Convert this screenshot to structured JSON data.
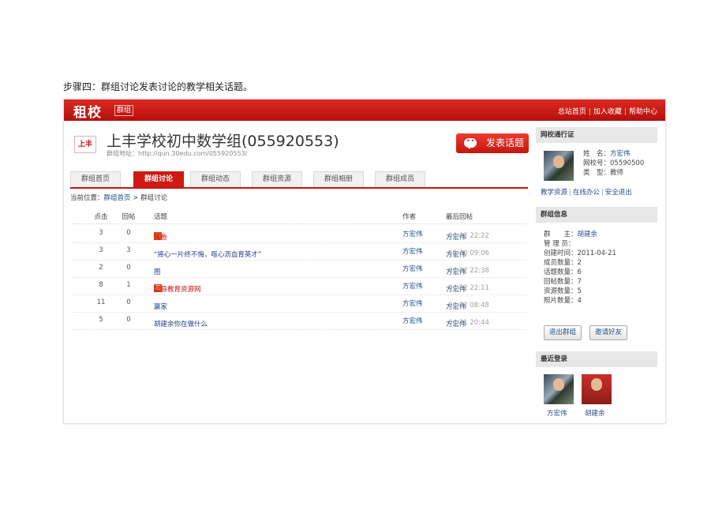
{
  "caption": "步骤四：群组讨论发表讨论的教学相关话题。",
  "topbar": {
    "logo": "租校",
    "badge": "群组",
    "links": [
      "总站首页",
      "加入收藏",
      "帮助中心"
    ]
  },
  "group": {
    "logo_text": "上丰",
    "title": "上丰学校初中数学组(055920553)",
    "url_label": "群组地址：",
    "url": "http://qun.30edu.com/055920553/",
    "post_button": "发表话题"
  },
  "tabs": [
    "群组首页",
    "群组讨论",
    "群组动态",
    "群组资源",
    "群组相册",
    "群组成员"
  ],
  "active_tab": "群组讨论",
  "breadcrumb": {
    "prefix": "当前位置：",
    "home": "群组首页",
    "sep": " > ",
    "current": "群组讨论"
  },
  "table": {
    "headers": {
      "clicks": "点击",
      "replies": "回帖",
      "topic": "话题",
      "author": "作者",
      "last": "最后回帖"
    },
    "rows": [
      {
        "clicks": "3",
        "replies": "0",
        "tag": "□",
        "topic": "鳄鱼",
        "author": "方宏伟",
        "last_user": "方宏伟",
        "last_time": "04-22 22:22"
      },
      {
        "clicks": "3",
        "replies": "3",
        "tag": "",
        "topic": "“捧心一片终不悔，呕心沥血育英才”",
        "author": "方宏伟",
        "last_user": "方宏伟",
        "last_time": "10-30 09:06"
      },
      {
        "clicks": "2",
        "replies": "0",
        "tag": "",
        "topic": "图",
        "author": "方宏伟",
        "last_user": "方宏伟",
        "last_time": "04-22 22:38"
      },
      {
        "clicks": "8",
        "replies": "1",
        "tag": "荐",
        "topic": "歙县教育资源网",
        "author": "方宏伟",
        "last_user": "方宏伟",
        "last_time": "04-22 22:11"
      },
      {
        "clicks": "11",
        "replies": "0",
        "tag": "",
        "topic": "赢家",
        "author": "方宏伟",
        "last_user": "方宏伟",
        "last_time": "04-22 08:48"
      },
      {
        "clicks": "5",
        "replies": "0",
        "tag": "",
        "topic": "胡建余你在做什么",
        "author": "方宏伟",
        "last_user": "方宏伟",
        "last_time": "04-21 20:44"
      }
    ]
  },
  "sidebar": {
    "pass_title": "网校通行证",
    "name_label": "姓　名：",
    "name": "方宏伟",
    "id_label": "网校号：",
    "id": "05590500",
    "type_label": "类　型：",
    "type": "教师",
    "quick_links": [
      "教学资源",
      "在线办公",
      "安全退出"
    ],
    "info_title": "群组信息",
    "info": {
      "owner_label": "群　　主：",
      "owner": "胡建余",
      "admin_label": "管 理 员：",
      "admin": "",
      "created_label": "创建时间：",
      "created": "2011-04-21",
      "members_label": "成员数量：",
      "members": "2",
      "topics_label": "话题数量：",
      "topics": "6",
      "replies_label": "回帖数量：",
      "replies": "7",
      "resources_label": "资源数量：",
      "resources": "5",
      "photos_label": "照片数量：",
      "photos": "4"
    },
    "quit_button": "退出群组",
    "invite_button": "邀请好友",
    "recent_title": "最近登录",
    "recent": [
      "方宏伟",
      "胡建余"
    ]
  }
}
